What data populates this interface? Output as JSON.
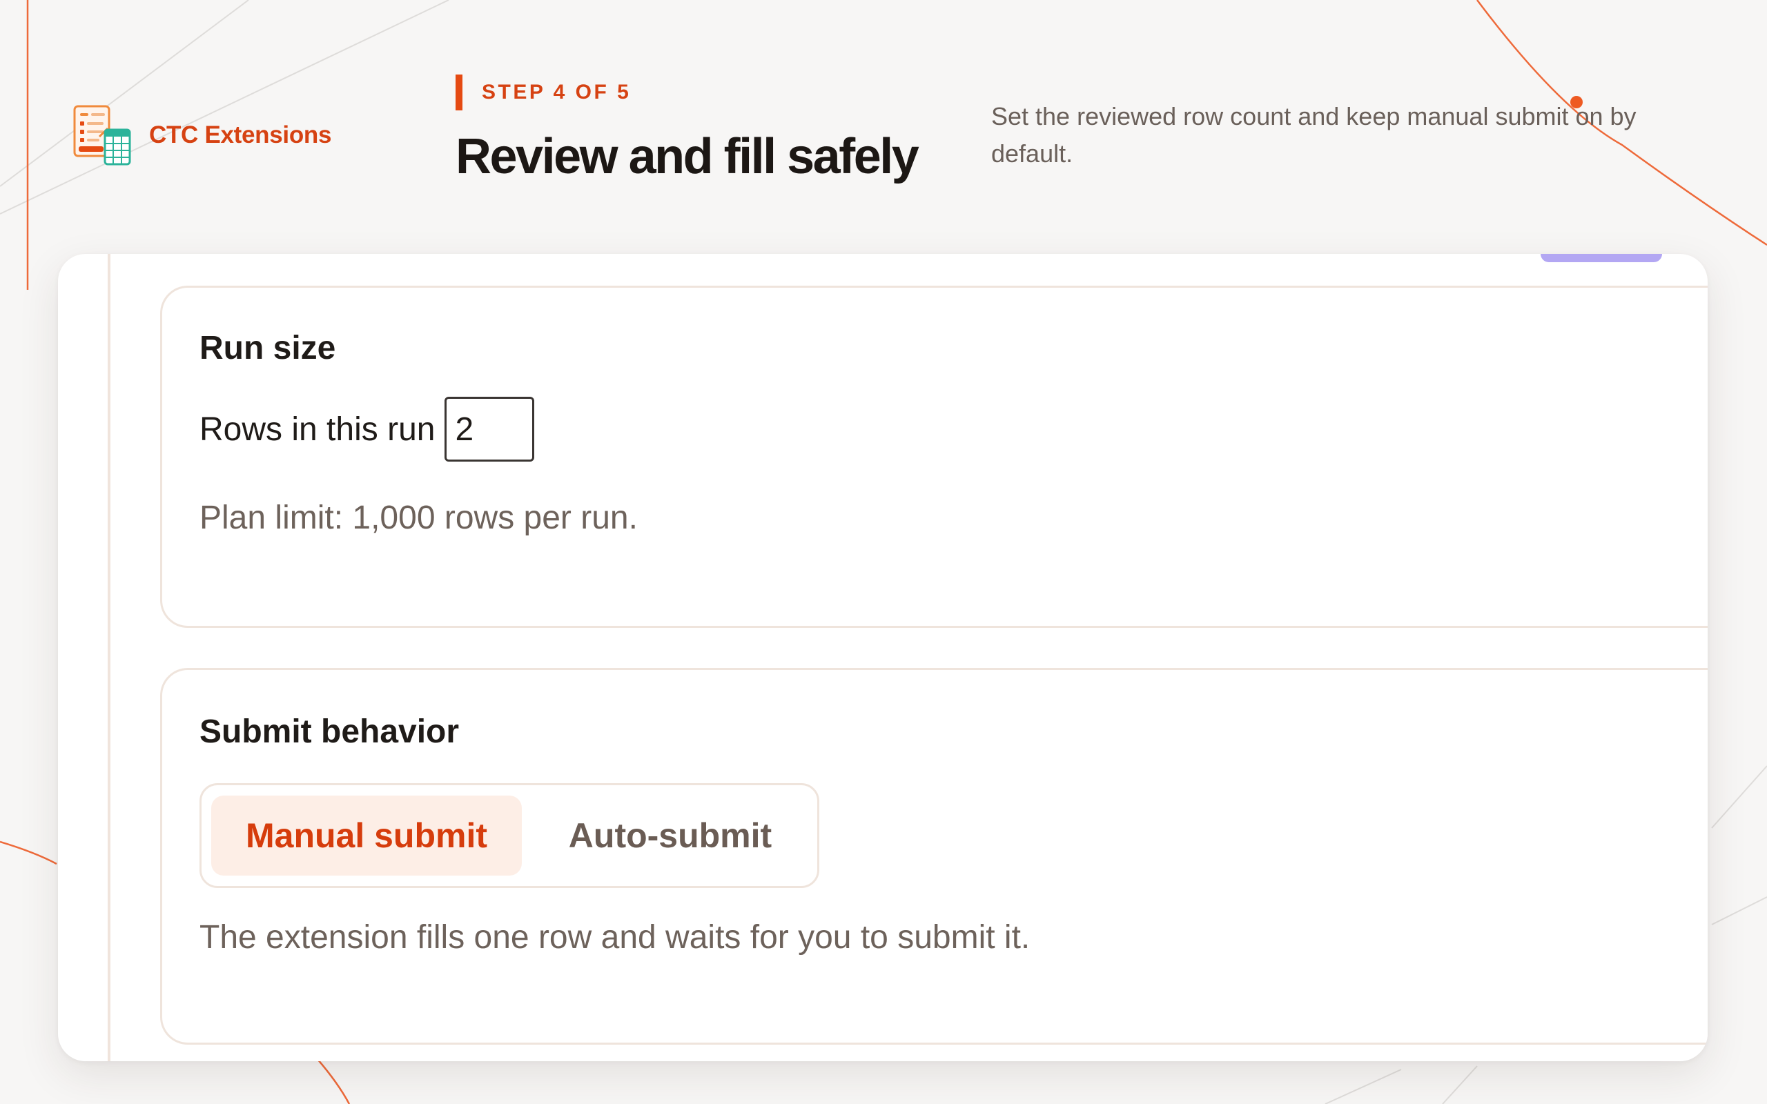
{
  "brand": {
    "name": "CTC Extensions",
    "logo_icon": "spreadsheet-form-icon"
  },
  "header": {
    "step_label": "STEP 4 OF 5",
    "title": "Review and fill safely",
    "description": "Set the reviewed row count and keep manual submit on by default."
  },
  "run_size": {
    "title": "Run size",
    "rows_label": "Rows in this run",
    "rows_value": "2",
    "plan_limit": "Plan limit: 1,000 rows per run."
  },
  "submit_behavior": {
    "title": "Submit behavior",
    "options": [
      {
        "label": "Manual submit",
        "selected": true
      },
      {
        "label": "Auto-submit",
        "selected": false
      }
    ],
    "helper": "The extension fills one row and waits for you to submit it."
  },
  "colors": {
    "accent": "#e54a12",
    "brand_text": "#d64212",
    "muted_text": "#6d625b",
    "border": "#efe4dc",
    "selected_bg": "#fdeee6",
    "tab_accent": "#b3a7f3"
  }
}
